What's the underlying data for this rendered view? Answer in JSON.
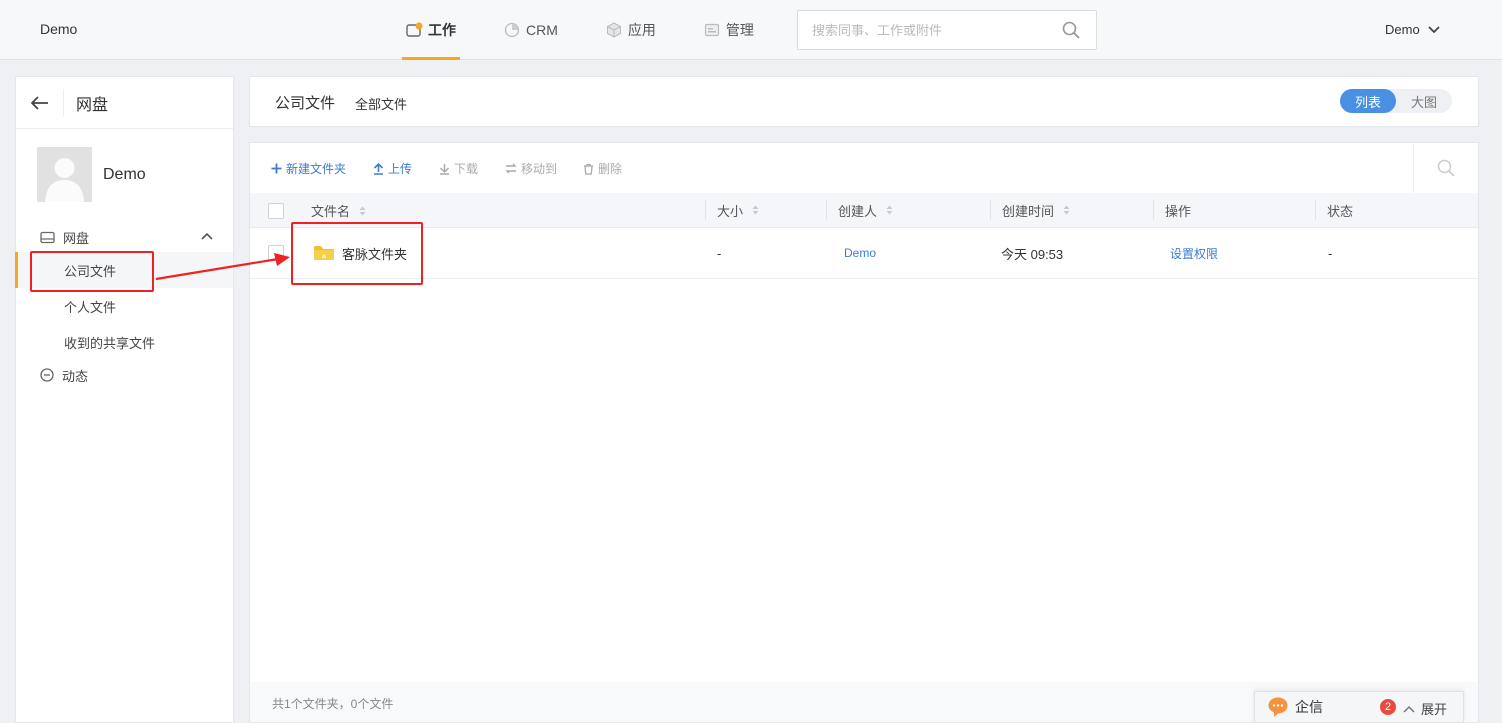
{
  "brand": "Demo",
  "nav": [
    {
      "label": "工作",
      "icon": "work-icon",
      "active": true
    },
    {
      "label": "CRM",
      "icon": "crm-icon",
      "active": false
    },
    {
      "label": "应用",
      "icon": "apps-icon",
      "active": false
    },
    {
      "label": "管理",
      "icon": "admin-icon",
      "active": false
    }
  ],
  "search": {
    "placeholder": "搜索同事、工作或附件"
  },
  "user": {
    "name": "Demo"
  },
  "sidebar": {
    "title": "网盘",
    "profile_name": "Demo",
    "group_disk": "网盘",
    "items": [
      {
        "label": "公司文件",
        "active": true
      },
      {
        "label": "个人文件",
        "active": false
      },
      {
        "label": "收到的共享文件",
        "active": false
      }
    ],
    "group_activity": "动态"
  },
  "breadcrumb": {
    "main": "公司文件",
    "sub": "全部文件"
  },
  "view_toggle": {
    "list": "列表",
    "grid": "大图",
    "selected": "list"
  },
  "toolbar": {
    "new_folder": "新建文件夹",
    "upload": "上传",
    "download": "下载",
    "move": "移动到",
    "delete": "删除"
  },
  "table": {
    "columns": [
      "文件名",
      "大小",
      "创建人",
      "创建时间",
      "操作",
      "状态"
    ],
    "rows": [
      {
        "name": "客脉文件夹",
        "size": "-",
        "creator": "Demo",
        "created": "今天 09:53",
        "action": "设置权限",
        "status": "-"
      }
    ]
  },
  "footer": {
    "summary": "共1个文件夹，0个文件"
  },
  "chat": {
    "label": "企信",
    "badge": "2",
    "expand": "展开"
  },
  "colors": {
    "accent": "#f5a623",
    "link": "#3b7bd4",
    "toggle": "#4a90e2",
    "annotation": "#ee2222"
  }
}
